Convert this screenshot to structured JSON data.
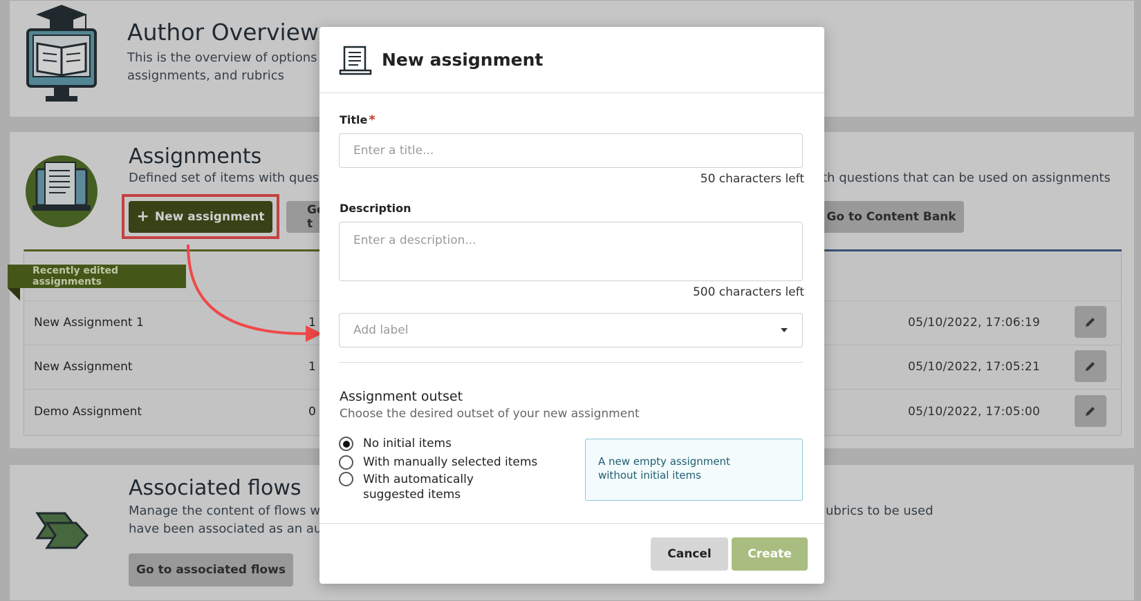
{
  "background": {
    "overview": {
      "title": "Author Overview",
      "subtitle_line1": "This is the overview of options",
      "subtitle_line2": "assignments, and rubrics"
    },
    "assignments": {
      "title": "Assignments",
      "subtitle": "Defined set of items with ques",
      "new_button_label": "New assignment",
      "goto_label_partial": "Go t",
      "content_bank_subtitle": "ith questions that can be used on assignments",
      "content_bank_button": "Go to Content Bank",
      "recent_banner": "Recently edited assignments",
      "rows": [
        {
          "name": "New Assignment 1",
          "mid": "1",
          "date": "05/10/2022, 17:06:19"
        },
        {
          "name": "New Assignment",
          "mid": "1",
          "date": "05/10/2022, 17:05:21"
        },
        {
          "name": "Demo Assignment",
          "mid": "0",
          "date": "05/10/2022, 17:05:00"
        }
      ]
    },
    "flows": {
      "title": "Associated flows",
      "subtitle_line1": "Manage the content of flows w",
      "subtitle_line2": "have been associated as an au",
      "right_text": "ubrics to be used",
      "button_label": "Go to associated flows"
    }
  },
  "modal": {
    "title": "New assignment",
    "title_field": {
      "label": "Title",
      "required_mark": "*",
      "placeholder": "Enter a title...",
      "counter": "50 characters left"
    },
    "description_field": {
      "label": "Description",
      "placeholder": "Enter a description...",
      "counter": "500 characters left"
    },
    "label_select": {
      "placeholder": "Add label"
    },
    "outset": {
      "title": "Assignment outset",
      "subtitle": "Choose the desired outset of your new assignment",
      "options": [
        {
          "label": "No initial items",
          "selected": true
        },
        {
          "label": "With manually selected items",
          "selected": false
        },
        {
          "label": "With automatically suggested items",
          "selected": false
        }
      ],
      "info_text": "A new empty assignment without initial items"
    },
    "footer": {
      "cancel_label": "Cancel",
      "create_label": "Create"
    }
  },
  "colors": {
    "brand_green": "#3b4a11",
    "highlight_red": "#f04848",
    "create_disabled": "#a9bd80"
  }
}
